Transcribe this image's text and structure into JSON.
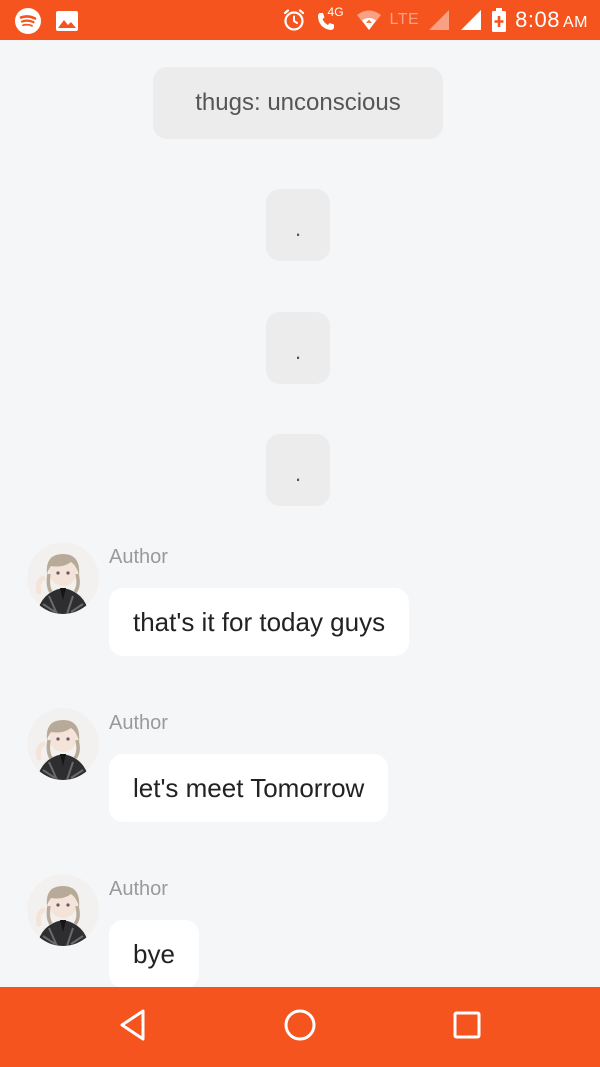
{
  "status_bar": {
    "network_label": "4G",
    "lte_label": "LTE",
    "time": "8:08",
    "ampm": "AM",
    "icons": [
      "spotify-icon",
      "gallery-icon",
      "alarm-icon",
      "volte-call-icon",
      "wifi-icon",
      "signal-icon",
      "signal-icon",
      "battery-charging-icon"
    ]
  },
  "chat": {
    "narration": "thugs: unconscious",
    "dots": [
      ".",
      ".",
      "."
    ],
    "messages": [
      {
        "author": "Author",
        "text": "that's it for today guys"
      },
      {
        "author": "Author",
        "text": "let's meet Tomorrow"
      },
      {
        "author": "Author",
        "text": "bye"
      }
    ]
  },
  "nav_bar": {
    "icons": [
      "back-icon",
      "home-icon",
      "recents-icon"
    ]
  },
  "colors": {
    "accent": "#f5541e",
    "background": "#f5f6f8",
    "system_bubble": "#ececec",
    "message_bubble": "#ffffff",
    "author_text": "#9a9a9a"
  }
}
